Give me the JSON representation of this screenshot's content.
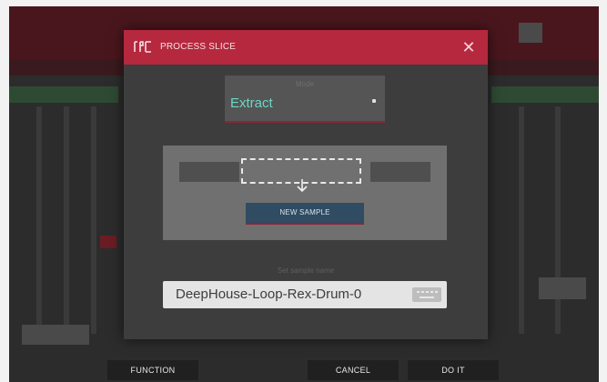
{
  "dialog": {
    "title": "PROCESS SLICE",
    "close_label": "✕",
    "mode_select": {
      "label": "Mode",
      "value": "Extract"
    },
    "diagram": {
      "button_label": "NEW SAMPLE"
    },
    "name_field": {
      "label": "Set sample name",
      "value": "DeepHouse-Loop-Rex-Drum-0"
    }
  },
  "footer": {
    "function_label": "FUNCTION",
    "cancel_label": "CANCEL",
    "do_it_label": "DO IT"
  },
  "colors": {
    "accent": "#b5283e",
    "value_text": "#6bd7c6",
    "button_blue": "#2f4c63"
  },
  "icons": {
    "logo": "mpc-logo-icon",
    "close": "close-icon",
    "dropdown": "dropdown-dot-icon",
    "arrow": "arrow-down-icon",
    "keyboard": "keyboard-icon"
  }
}
